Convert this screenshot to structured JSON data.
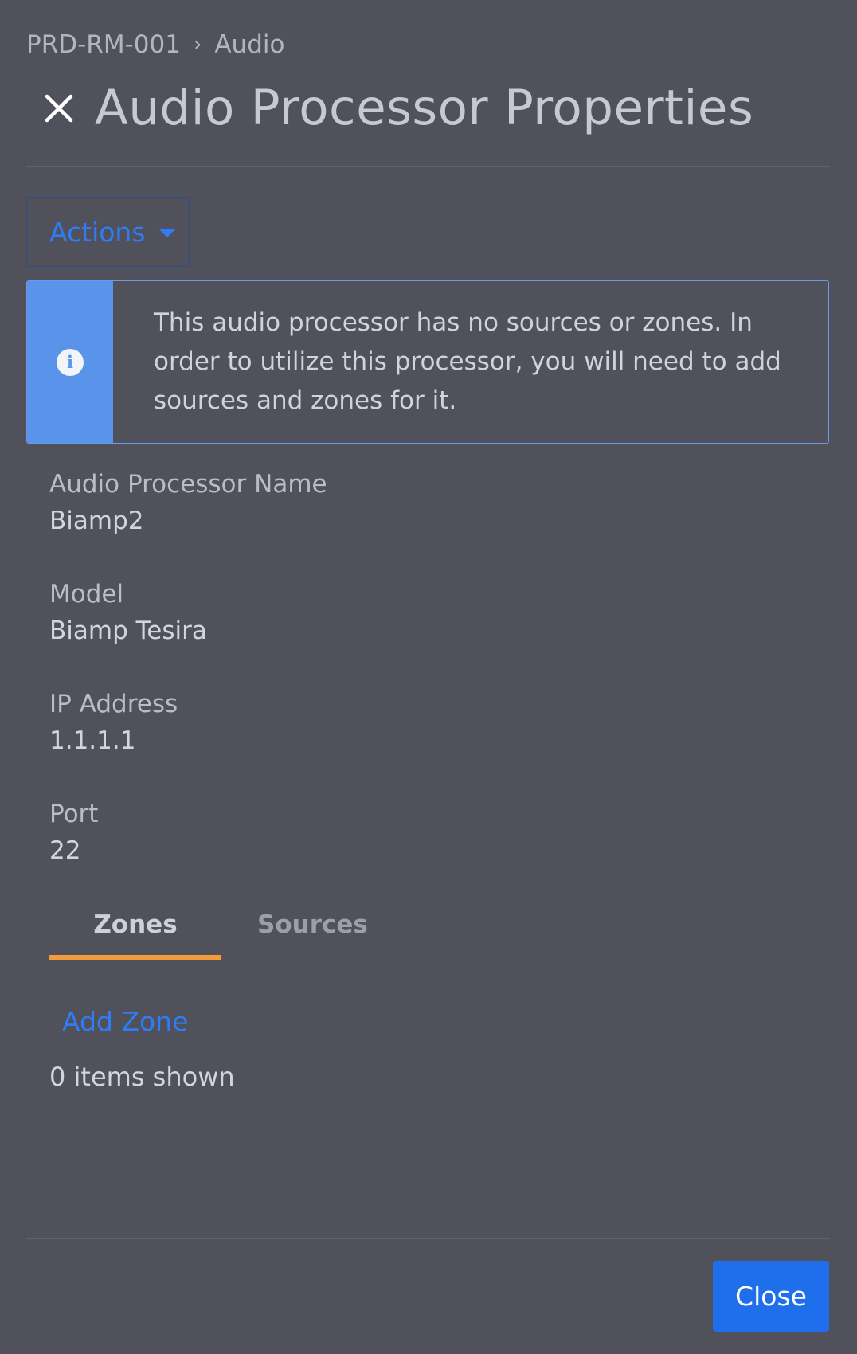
{
  "breadcrumb": {
    "parent": "PRD-RM-001",
    "separator": "›",
    "current": "Audio"
  },
  "header": {
    "title": "Audio Processor Properties",
    "close_icon": "close-icon"
  },
  "toolbar": {
    "actions_label": "Actions",
    "actions_icon": "caret-down-icon"
  },
  "info_banner": {
    "icon": "info-icon",
    "icon_glyph": "i",
    "message": "This audio processor has no sources or zones. In order to utilize this processor, you will need to add sources and zones for it."
  },
  "fields": [
    {
      "label": "Audio Processor Name",
      "value": "Biamp2"
    },
    {
      "label": "Model",
      "value": "Biamp Tesira"
    },
    {
      "label": "IP Address",
      "value": "1.1.1.1"
    },
    {
      "label": "Port",
      "value": "22"
    }
  ],
  "tabs": [
    {
      "label": "Zones",
      "active": true
    },
    {
      "label": "Sources",
      "active": false
    }
  ],
  "zones": {
    "add_label": "Add Zone",
    "count_text": "0 items shown"
  },
  "footer": {
    "close_label": "Close"
  },
  "colors": {
    "background": "#50515a",
    "accent_blue": "#2f7cf6",
    "button_blue": "#1f6fec",
    "info_strip": "#5a94ea",
    "tab_underline": "#f39c3c"
  }
}
